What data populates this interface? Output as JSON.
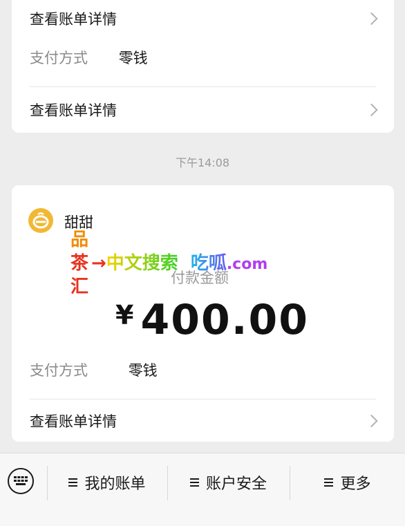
{
  "top_card": {
    "bill_details_label": "查看账单详情",
    "payment_method_label": "支付方式",
    "payment_method_value": "零钱",
    "bill_details_label_2": "查看账单详情"
  },
  "timestamp": "下午14:08",
  "main_card": {
    "merchant_name": "甜甜",
    "amount_label": "付款金额",
    "currency_symbol": "¥",
    "amount": "400.00",
    "payment_method_label": "支付方式",
    "payment_method_value": "零钱",
    "bill_details_label": "查看账单详情"
  },
  "watermark": {
    "chars": [
      "品",
      "茶",
      "汇"
    ],
    "arrow": "→",
    "text_1": "中文搜索",
    "text_2": "吃呱",
    "text_3": ".com"
  },
  "bottom_menu": {
    "items": [
      {
        "label": "我的账单"
      },
      {
        "label": "账户安全"
      },
      {
        "label": "更多"
      }
    ]
  },
  "colors": {
    "background": "#ededed",
    "card": "#ffffff",
    "logo": "#f2b835",
    "wm_orange": "#f08a00",
    "wm_red": "#e8321e",
    "wm_yellow": "#f5d200",
    "wm_green": "#39d02b",
    "wm_cyan": "#1fb5e8",
    "wm_violet": "#b23cf0"
  }
}
